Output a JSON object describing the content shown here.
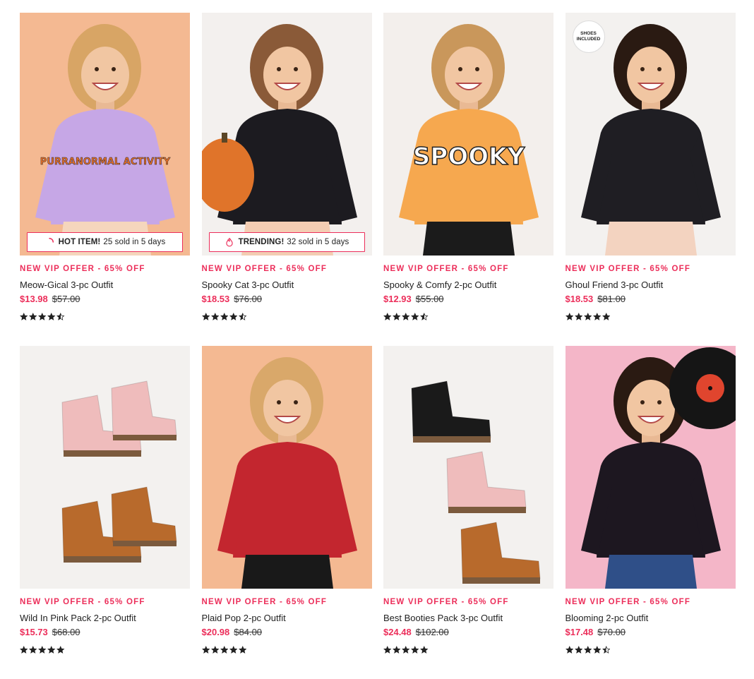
{
  "colors": {
    "accent": "#ec2e5a",
    "text": "#222222"
  },
  "products": [
    {
      "id": "meow",
      "offer": "NEW VIP OFFER - 65% OFF",
      "name": "Meow-Gical 3-pc Outfit",
      "sale_price": "$13.98",
      "original_price": "$57.00",
      "rating": 4.5,
      "badge": {
        "icon": "spinner-icon",
        "label": "HOT ITEM!",
        "text": "25 sold in 5 days"
      },
      "image": {
        "bg": "#f4b992",
        "top": "#c6a7e6",
        "top_text": "PURRANORMAL ACTIVITY",
        "bottom": "#f5d6bd",
        "hair": "#d8a565"
      }
    },
    {
      "id": "spooky-cat",
      "offer": "NEW VIP OFFER - 65% OFF",
      "name": "Spooky Cat 3-pc Outfit",
      "sale_price": "$18.53",
      "original_price": "$76.00",
      "rating": 4.5,
      "badge": {
        "icon": "flame-icon",
        "label": "TRENDING!",
        "text": "32 sold in 5 days"
      },
      "image": {
        "bg": "#f3f0ee",
        "top": "#1c1b20",
        "top_text": "",
        "bottom": "#f3cdb3",
        "hair": "#8a5a38"
      }
    },
    {
      "id": "spooky-comfy",
      "offer": "NEW VIP OFFER - 65% OFF",
      "name": "Spooky & Comfy 2-pc Outfit",
      "sale_price": "$12.93",
      "original_price": "$55.00",
      "rating": 4.7,
      "badge": null,
      "image": {
        "bg": "#f3efec",
        "top": "#f6a84f",
        "top_text": "SPOOKY",
        "bottom": "#1b1b1b",
        "hair": "#c9975b"
      }
    },
    {
      "id": "ghoul-friend",
      "offer": "NEW VIP OFFER - 65% OFF",
      "name": "Ghoul Friend 3-pc Outfit",
      "sale_price": "$18.53",
      "original_price": "$81.00",
      "rating": 5,
      "badge": null,
      "shoes_tag": "SHOES INCLUDED",
      "image": {
        "bg": "#f3f1ef",
        "top": "#1f1e23",
        "top_text": "",
        "bottom": "#f3d3c0",
        "hair": "#2a1a12"
      }
    },
    {
      "id": "wild-in-pink",
      "offer": "NEW VIP OFFER - 65% OFF",
      "name": "Wild In Pink Pack 2-pc Outfit",
      "sale_price": "$15.73",
      "original_price": "$68.00",
      "rating": 5,
      "badge": null,
      "image": {
        "bg": "#f3f1ef",
        "boots": [
          "#efbcbc",
          "#b86a2c"
        ]
      }
    },
    {
      "id": "plaid-pop",
      "offer": "NEW VIP OFFER - 65% OFF",
      "name": "Plaid Pop 2-pc Outfit",
      "sale_price": "$20.98",
      "original_price": "$84.00",
      "rating": 5,
      "badge": null,
      "image": {
        "bg": "#f4b992",
        "top": "#c3262f",
        "top_text": "",
        "bottom": "#191919",
        "hair": "#d9a86a"
      }
    },
    {
      "id": "best-booties",
      "offer": "NEW VIP OFFER - 65% OFF",
      "name": "Best Booties Pack 3-pc Outfit",
      "sale_price": "$24.48",
      "original_price": "$102.00",
      "rating": 5,
      "badge": null,
      "image": {
        "bg": "#f3f1ef",
        "boots": [
          "#1a1a1a",
          "#efbcbc",
          "#b86a2c"
        ]
      }
    },
    {
      "id": "blooming",
      "offer": "NEW VIP OFFER - 65% OFF",
      "name": "Blooming 2-pc Outfit",
      "sale_price": "$17.48",
      "original_price": "$70.00",
      "rating": 4.5,
      "badge": null,
      "image": {
        "bg": "#f4b6c8",
        "top": "#1d1720",
        "top_text": "",
        "bottom": "#2f4f88",
        "hair": "#2a1a12",
        "record": true
      }
    }
  ]
}
